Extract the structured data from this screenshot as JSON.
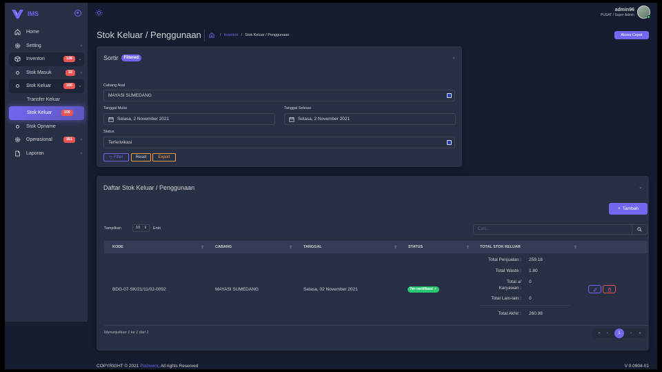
{
  "app": {
    "name": "IMS"
  },
  "user": {
    "name": "admin96",
    "role": "PUSAT / Super Admin"
  },
  "sidebar": {
    "items": [
      {
        "label": "Home",
        "icon": "home-icon"
      },
      {
        "label": "Setting",
        "icon": "gear-icon"
      },
      {
        "label": "Inventori",
        "icon": "package-icon",
        "badge": "138"
      },
      {
        "label": "Stok Masuk",
        "icon": "circle-icon",
        "badge": "33"
      },
      {
        "label": "Stok Keluar",
        "icon": "circle-icon",
        "badge": "105"
      },
      {
        "label": "Transfer Keluar"
      },
      {
        "label": "Stok Keluar",
        "badge": "105"
      },
      {
        "label": "Stok Opname",
        "icon": "circle-icon"
      },
      {
        "label": "Operasional",
        "icon": "gear-icon",
        "badge": "301"
      },
      {
        "label": "Laporan",
        "icon": "file-icon"
      }
    ]
  },
  "header": {
    "title": "Stok Keluar / Penggunaan",
    "breadcrumb": {
      "link": "Inventori",
      "current": "Stok Keluar / Penggunaan"
    },
    "quick_access": "Akses Cepat"
  },
  "filter": {
    "title": "Sortir",
    "badge": "Filtered",
    "cabang_label": "Cabang Asal",
    "cabang_value": "MAYASI SUMEDANG",
    "start_label": "Tanggal Mulai",
    "start_value": "Selasa, 2 November 2021",
    "end_label": "Tanggal Selesai",
    "end_value": "Selasa, 2 November 2021",
    "status_label": "Status",
    "status_value": "Terferivikasi",
    "buttons": {
      "filter": "Filter",
      "reset": "Reset",
      "export": "Export"
    }
  },
  "list": {
    "title": "Daftar Stok Keluar / Penggunaan",
    "add_button": "Tambah",
    "show_prefix": "Tampilkan",
    "show_value": "10",
    "show_suffix": "Entri",
    "search_placeholder": "Cari...",
    "columns": [
      "KODE",
      "CABANG",
      "TANGGAL",
      "STATUS",
      "TOTAL STOK KELUAR"
    ],
    "row": {
      "kode": "BDG-07-SK/21/11/02-0092",
      "cabang": "MAYASI SUMEDANG",
      "tanggal": "Selasa, 02 November 2021",
      "status": "Ter-verifikasi",
      "totals": [
        {
          "label": "Total Penjualan :",
          "value": "259.18"
        },
        {
          "label": "Total Waste :",
          "value": "1.80"
        },
        {
          "label": "Total u/",
          "label2": "Karyawan :",
          "value": "0"
        },
        {
          "label": "Total Lain-lain :",
          "value": "0"
        },
        {
          "label": "Total Akhir :",
          "value": "260.98"
        }
      ]
    },
    "info": "Menunjukkan 1 ke 1 dari 1",
    "page": "1"
  },
  "footer": {
    "copyright": "COPYRIGHT © 2021",
    "brand": "Pixinvent",
    "rights": ", All rights Reserved",
    "version": "V 0.0904-01"
  },
  "colors": {
    "primary": "#7367f0",
    "danger": "#ea5455",
    "success": "#28c76f",
    "warning": "#ff9f43",
    "body": "#161d31",
    "card": "#283046"
  }
}
